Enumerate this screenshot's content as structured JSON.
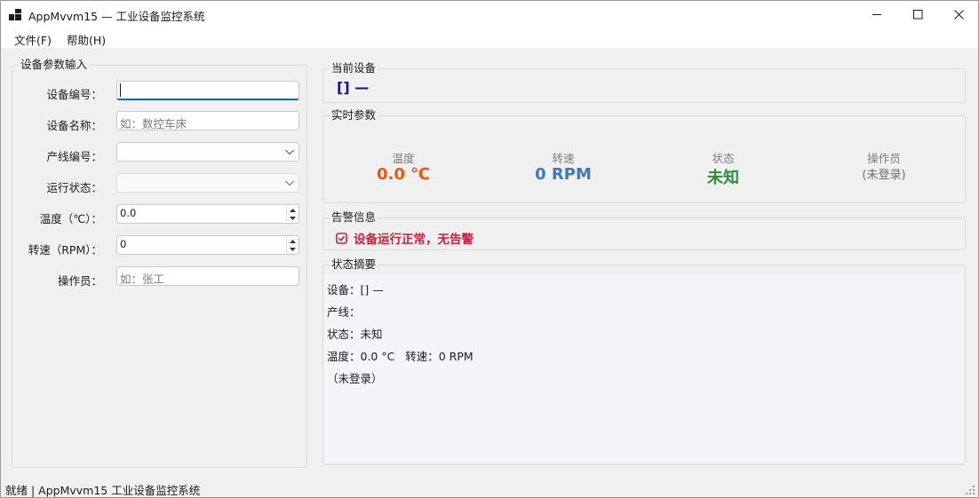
{
  "window": {
    "title": "AppMvvm15 — 工业设备监控系统",
    "controls": [
      "minimize-icon",
      "maximize-icon",
      "close-icon"
    ]
  },
  "menu": {
    "file": "文件(F)",
    "help": "帮助(H)"
  },
  "input_group": {
    "title": "设备参数输入",
    "fields": {
      "device_id": {
        "label": "设备编号：",
        "value": ""
      },
      "device_name": {
        "label": "设备名称：",
        "placeholder": "如：数控车床"
      },
      "line_no": {
        "label": "产线编号：",
        "value": ""
      },
      "run_state": {
        "label": "运行状态：",
        "value": ""
      },
      "temperature": {
        "label": "温度（℃）：",
        "value": "0.0"
      },
      "speed": {
        "label": "转速（RPM）：",
        "value": "0"
      },
      "operator": {
        "label": "操作员：",
        "placeholder": "如：张工"
      }
    }
  },
  "current_device": {
    "title": "当前设备",
    "value": "[] —"
  },
  "realtime": {
    "title": "实时参数",
    "temperature": {
      "label": "温度",
      "value": "0.0 ℃",
      "color": "#e8590c"
    },
    "speed": {
      "label": "转速",
      "value": "0 RPM",
      "color": "#3d7ab8"
    },
    "state": {
      "label": "状态",
      "value": "未知",
      "color": "#2e8b3e"
    },
    "operator": {
      "label": "操作员",
      "value": "(未登录)"
    }
  },
  "alarm": {
    "title": "告警信息",
    "message": "设备运行正常，无告警",
    "icon": "checkbox-check-icon",
    "color": "#cc1d3d"
  },
  "summary": {
    "title": "状态摘要",
    "lines": [
      "设备：[] —",
      "产线：",
      "状态：未知",
      "温度：0.0 °C   转速：0 RPM",
      "（未登录）"
    ]
  },
  "statusbar": {
    "text": "就绪 | AppMvvm15 工业设备监控系统"
  }
}
